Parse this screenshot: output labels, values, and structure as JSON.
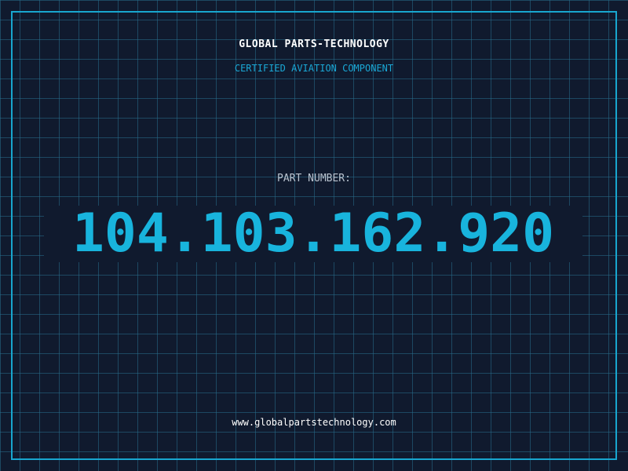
{
  "header": {
    "company": "GLOBAL PARTS-TECHNOLOGY",
    "subtitle": "CERTIFIED AVIATION COMPONENT"
  },
  "part": {
    "label": "PART NUMBER:",
    "number": "104.103.162.920"
  },
  "footer": {
    "url": "www.globalpartstechnology.com"
  },
  "colors": {
    "background": "#101a2e",
    "accent": "#18b4dd",
    "grid": "#286e8c",
    "label": "#b9c3cf"
  }
}
